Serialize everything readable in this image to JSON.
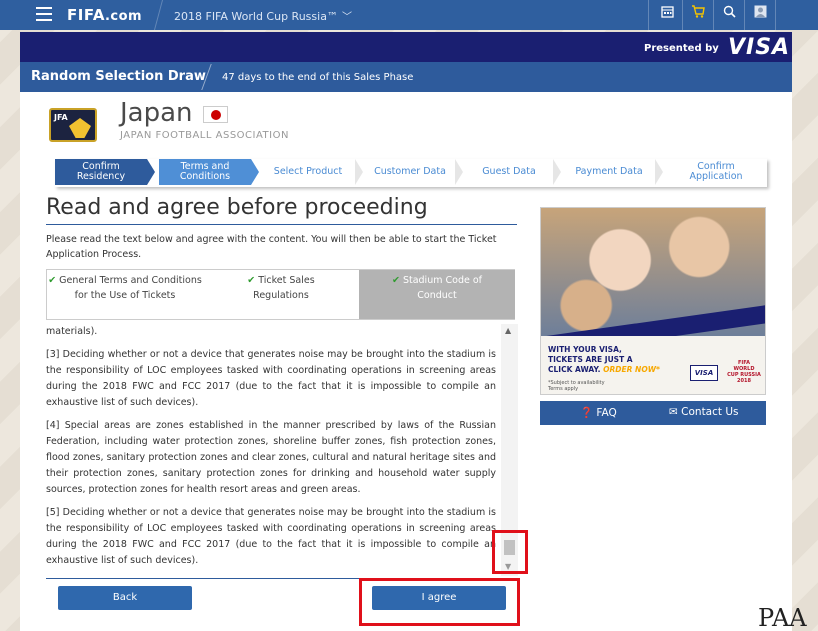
{
  "topbar": {
    "logo": "FIFA",
    "logo_suffix": ".com",
    "event": "2018 FIFA World Cup Russia™",
    "event_chevron": "﹀",
    "icons": [
      "calendar-icon",
      "cart-icon",
      "search-icon",
      "user-icon"
    ]
  },
  "sponsor": {
    "presented_by": "Presented by",
    "brand": "VISA"
  },
  "header": {
    "title": "Random Selection Draw",
    "phase": "47 days to the end of this Sales Phase"
  },
  "association": {
    "crest_text": "JFA",
    "country": "Japan",
    "full_name": "JAPAN FOOTBALL ASSOCIATION"
  },
  "steps": [
    {
      "label": "Confirm Residency",
      "state": "done"
    },
    {
      "label": "Terms and Conditions",
      "state": "active"
    },
    {
      "label": "Select Product",
      "state": "todo"
    },
    {
      "label": "Customer Data",
      "state": "todo"
    },
    {
      "label": "Guest Data",
      "state": "todo"
    },
    {
      "label": "Payment Data",
      "state": "todo"
    },
    {
      "label": "Confirm Application",
      "state": "todo"
    }
  ],
  "main": {
    "heading": "Read and agree before proceeding",
    "intro": "Please read the text below and agree with the content. You will then be able to start the Ticket Application Process.",
    "tabs": [
      {
        "label": "General Terms and Conditions for the Use of Tickets",
        "checked": true
      },
      {
        "label": "Ticket Sales Regulations",
        "checked": true
      },
      {
        "label": "Stadium Code of Conduct",
        "checked": true,
        "active": true
      }
    ],
    "content": [
      "materials).",
      "[3] Deciding whether or not a device that generates noise may be brought into the stadium is the responsibility of LOC employees tasked with coordinating operations in screening areas during the 2018 FWC and FCC 2017 (due to the fact that it is impossible to compile an exhaustive list of such devices).",
      "[4] Special areas are zones established in the manner prescribed by laws of the Russian Federation, including water protection zones, shoreline buffer zones, fish protection zones, flood zones, sanitary protection zones and clear zones, cultural and natural heritage sites and their protection zones, sanitary protection zones for drinking and household water supply sources, protection zones for health resort areas and green areas.",
      "[5] Deciding whether or not a device that generates noise may be brought into the stadium is the responsibility of LOC employees tasked with coordinating operations in screening areas during the 2018 FWC and FCC 2017 (due to the fact that it is impossible to compile an exhaustive list of such devices)."
    ],
    "back_label": "Back",
    "agree_label": "I agree"
  },
  "ad": {
    "line1": "WITH YOUR VISA,",
    "line2": "TICKETS ARE JUST A",
    "line3": "CLICK AWAY.",
    "order_now": "ORDER NOW*",
    "fine_print_1": "*Subject to availability",
    "fine_print_2": "Terms apply",
    "brand": "VISA",
    "wc": "FIFA WORLD CUP RUSSIA 2018"
  },
  "help": {
    "faq": "FAQ",
    "contact": "Contact Us"
  },
  "watermark": "PAA",
  "colors": {
    "nav_blue": "#2f5f9f",
    "visa_navy": "#1a1f71",
    "step_done": "#2e5b9c",
    "step_active": "#4f8fd6",
    "highlight_red": "#e0101a"
  }
}
